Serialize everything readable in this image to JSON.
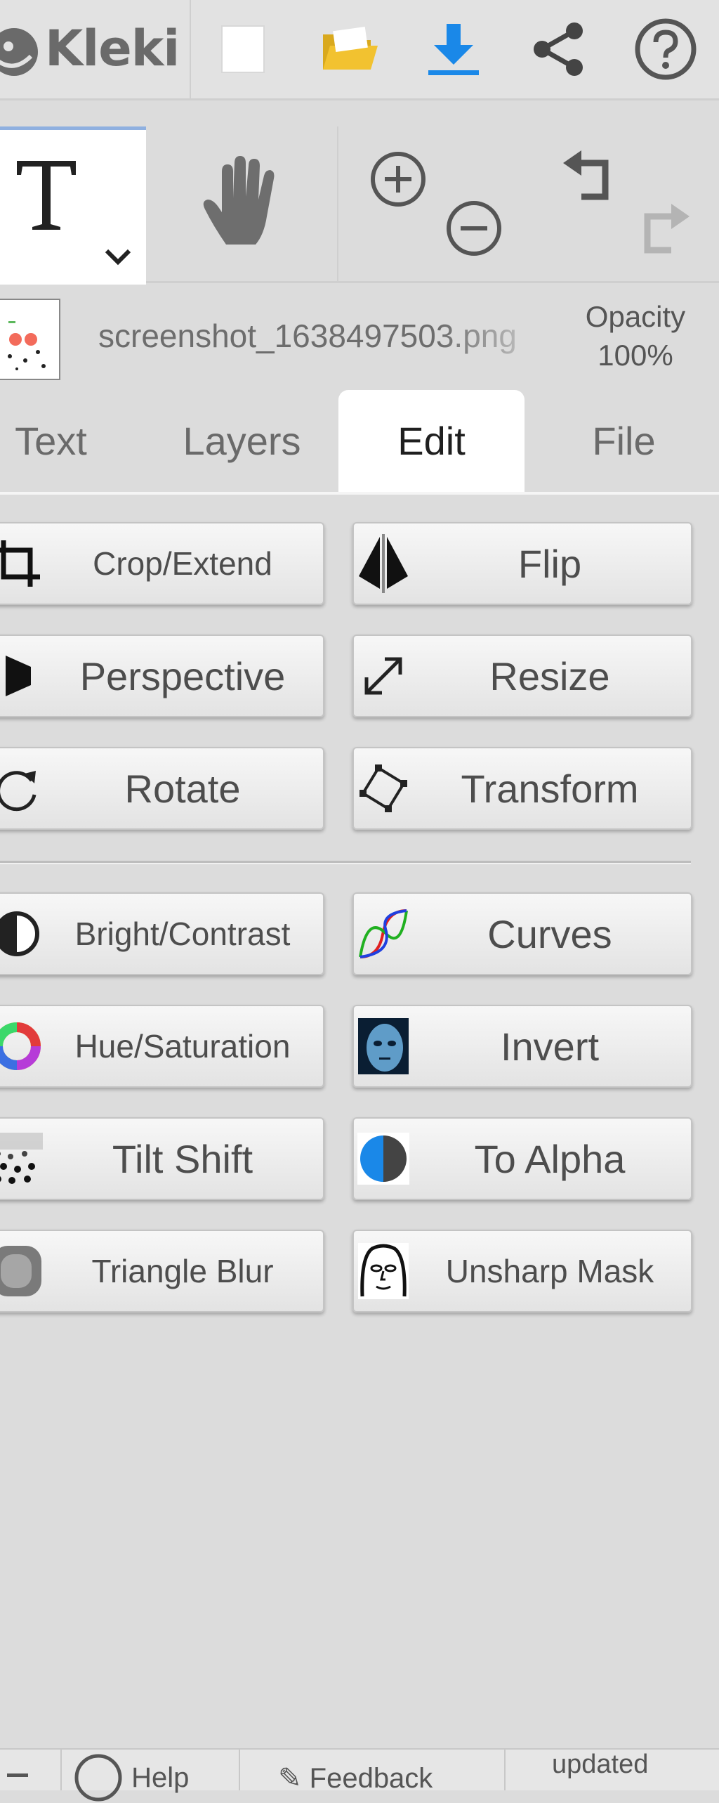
{
  "app": {
    "name": "Kleki"
  },
  "topbar": {
    "icons": [
      "new-image-icon",
      "open-folder-icon",
      "download-icon",
      "share-icon",
      "help-icon"
    ]
  },
  "tools": {
    "active": "text-tool",
    "items": [
      "text-tool-icon",
      "hand-tool-icon",
      "zoom-in-icon",
      "zoom-out-icon",
      "undo-icon",
      "redo-icon"
    ]
  },
  "layer": {
    "filename": "screenshot_1638497503.png",
    "opacity_label": "Opacity",
    "opacity_value": "100%"
  },
  "tabs": [
    {
      "label": "Text",
      "active": false
    },
    {
      "label": "Layers",
      "active": false
    },
    {
      "label": "Edit",
      "active": true
    },
    {
      "label": "File",
      "active": false
    }
  ],
  "edit": {
    "transform_buttons": [
      {
        "label": "Crop/Extend",
        "icon": "crop-icon"
      },
      {
        "label": "Flip",
        "icon": "flip-icon"
      },
      {
        "label": "Perspective",
        "icon": "perspective-icon"
      },
      {
        "label": "Resize",
        "icon": "resize-icon"
      },
      {
        "label": "Rotate",
        "icon": "rotate-icon"
      },
      {
        "label": "Transform",
        "icon": "transform-icon"
      }
    ],
    "filter_buttons": [
      {
        "label": "Bright/Contrast",
        "icon": "bright-contrast-icon"
      },
      {
        "label": "Curves",
        "icon": "curves-icon"
      },
      {
        "label": "Hue/Saturation",
        "icon": "hue-saturation-icon"
      },
      {
        "label": "Invert",
        "icon": "invert-icon"
      },
      {
        "label": "Tilt Shift",
        "icon": "tilt-shift-icon"
      },
      {
        "label": "To Alpha",
        "icon": "to-alpha-icon"
      },
      {
        "label": "Triangle Blur",
        "icon": "triangle-blur-icon"
      },
      {
        "label": "Unsharp Mask",
        "icon": "unsharp-mask-icon"
      }
    ]
  },
  "bottombar": {
    "help_label": "Help",
    "feedback_label": "Feedback",
    "updated_label": "updated"
  },
  "colors": {
    "download_blue": "#1a88e8",
    "folder_yellow": "#f2c230",
    "active_tab_bg": "#ffffff",
    "app_bg": "#dcdcdc"
  }
}
